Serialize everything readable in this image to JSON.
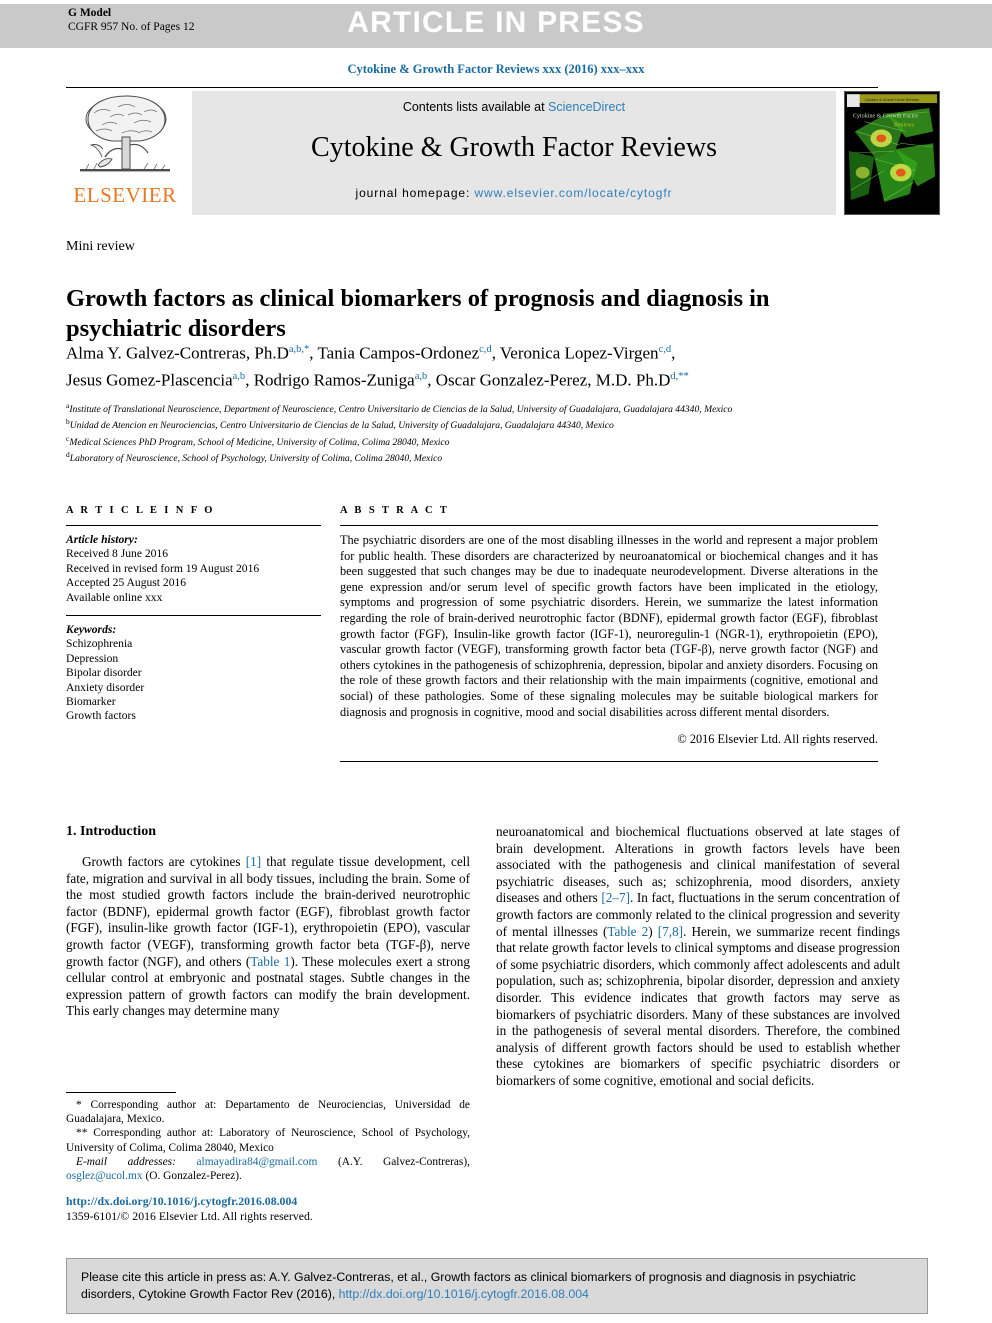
{
  "banner": {
    "g_model_line1": "G Model",
    "g_model_line2": "CGFR 957 No. of Pages 12",
    "article_in_press": "ARTICLE IN PRESS"
  },
  "running_head": "Cytokine & Growth Factor Reviews xxx (2016) xxx–xxx",
  "masthead": {
    "contents_prefix": "Contents lists available at ",
    "sciencedirect": "ScienceDirect",
    "journal_title": "Cytokine & Growth Factor Reviews",
    "homepage_prefix": "journal homepage: ",
    "homepage_url": "www.elsevier.com/locate/cytogfr",
    "publisher": "ELSEVIER",
    "cover_title": "Cytokine & Growth Factor",
    "cover_subtitle": "Reviews"
  },
  "article": {
    "type": "Mini review",
    "title": "Growth factors as clinical biomarkers of prognosis and diagnosis in psychiatric disorders",
    "authors_line1_a": "Alma Y. Galvez-Contreras, Ph.D",
    "authors_line1_a_sup": "a,b,*",
    "authors_line1_b": ", Tania Campos-Ordonez",
    "authors_line1_b_sup": "c,d",
    "authors_line1_c": ", Veronica Lopez-Virgen",
    "authors_line1_c_sup": "c,d",
    "authors_line1_d": ",",
    "authors_line2_a": "Jesus Gomez-Plascencia",
    "authors_line2_a_sup": "a,b",
    "authors_line2_b": ", Rodrigo Ramos-Zuniga",
    "authors_line2_b_sup": "a,b",
    "authors_line2_c": ", Oscar Gonzalez-Perez, M.D. Ph.D",
    "authors_line2_c_sup": "d,**",
    "affiliations": [
      {
        "mark": "a",
        "text": "Institute of Translational Neuroscience, Department of Neuroscience, Centro Universitario de Ciencias de la Salud, University of Guadalajara, Guadalajara 44340, Mexico"
      },
      {
        "mark": "b",
        "text": "Unidad de Atencion en Neurociencias, Centro Universitario de Ciencias de la Salud, University of Guadalajara, Guadalajara 44340, Mexico"
      },
      {
        "mark": "c",
        "text": "Medical Sciences PhD Program, School of Medicine, University of Colima, Colima 28040, Mexico"
      },
      {
        "mark": "d",
        "text": "Laboratory of Neuroscience, School of Psychology, University of Colima, Colima 28040, Mexico"
      }
    ]
  },
  "article_info": {
    "heading": "A R T I C L E  I N F O",
    "history_label": "Article history:",
    "history": [
      "Received 8 June 2016",
      "Received in revised form 19 August 2016",
      "Accepted 25 August 2016",
      "Available online xxx"
    ],
    "keywords_label": "Keywords:",
    "keywords": [
      "Schizophrenia",
      "Depression",
      "Bipolar disorder",
      "Anxiety disorder",
      "Biomarker",
      "Growth factors"
    ]
  },
  "abstract": {
    "heading": "A B S T R A C T",
    "text": "The psychiatric disorders are one of the most disabling illnesses in the world and represent a major problem for public health. These disorders are characterized by neuroanatomical or biochemical changes and it has been suggested that such changes may be due to inadequate neurodevelopment. Diverse alterations in the gene expression and/or serum level of specific growth factors have been implicated in the etiology, symptoms and progression of some psychiatric disorders. Herein, we summarize the latest information regarding the role of brain-derived neurotrophic factor (BDNF), epidermal growth factor (EGF), fibroblast growth factor (FGF), Insulin-like growth factor (IGF-1), neuroregulin-1 (NGR-1), erythropoietin (EPO), vascular growth factor (VEGF), transforming growth factor beta (TGF-β), nerve growth factor (NGF) and others cytokines in the pathogenesis of schizophrenia, depression, bipolar and anxiety disorders. Focusing on the role of these growth factors and their relationship with the main impairments (cognitive, emotional and social) of these pathologies. Some of these signaling molecules may be suitable biological markers for diagnosis and prognosis in cognitive, mood and social disabilities across different mental disorders.",
    "copyright": "© 2016 Elsevier Ltd. All rights reserved."
  },
  "body": {
    "section_heading": "1. Introduction",
    "left_paragraph_parts": {
      "p1": "Growth factors are cytokines ",
      "ref1": "[1]",
      "p2": " that regulate tissue development, cell fate, migration and survival in all body tissues, including the brain. Some of the most studied growth factors include the brain-derived neurotrophic factor (BDNF), epidermal growth factor (EGF), fibroblast growth factor (FGF), insulin-like growth factor (IGF-1), erythropoietin (EPO), vascular growth factor (VEGF), transforming growth factor beta (TGF-β), nerve growth factor (NGF), and others (",
      "ref2": "Table 1",
      "p3": "). These molecules exert a strong cellular control at embryonic and postnatal stages. Subtle changes in the expression pattern of growth factors can modify the brain development. This early changes may determine many"
    },
    "right_paragraph_parts": {
      "p1": "neuroanatomical and biochemical fluctuations observed at late stages of brain development. Alterations in growth factors levels have been associated with the pathogenesis and clinical manifestation of several psychiatric diseases, such as; schizophrenia, mood disorders, anxiety diseases and others ",
      "ref1": "[2–7]",
      "p2": ". In fact, fluctuations in the serum concentration of growth factors are commonly related to the clinical progression and severity of mental illnesses (",
      "ref2": "Table 2",
      "p3": ") ",
      "ref3": "[7,8]",
      "p4": ". Herein, we summarize recent findings that relate growth factor levels to clinical symptoms and disease progression of some psychiatric disorders, which commonly affect adolescents and adult population, such as; schizophrenia, bipolar disorder, depression and anxiety disorder. This evidence indicates that growth factors may serve as biomarkers of psychiatric disorders. Many of these substances are involved in the pathogenesis of several mental disorders. Therefore, the combined analysis of different growth factors should be used to establish whether these cytokines are biomarkers of specific psychiatric disorders or biomarkers of some cognitive, emotional and social deficits."
    }
  },
  "footnotes": {
    "note1_mark": "*",
    "note1": " Corresponding author at: Departamento de Neurociencias, Universidad de Guadalajara, Mexico.",
    "note2_mark": "**",
    "note2": " Corresponding author at: Laboratory of Neuroscience, School of Psychology, University of Colima, Colima 28040, Mexico",
    "email_label": "E-mail addresses:",
    "email1": "almayadira84@gmail.com",
    "email1_owner": " (A.Y. Galvez-Contreras),",
    "email2": "osglez@ucol.mx",
    "email2_owner": " (O. Gonzalez-Perez)."
  },
  "doi_block": {
    "doi_url": "http://dx.doi.org/10.1016/j.cytogfr.2016.08.004",
    "issn_line": "1359-6101/© 2016 Elsevier Ltd. All rights reserved."
  },
  "cite_box": {
    "text_a": "Please cite this article in press as: A.Y. Galvez-Contreras, et al., Growth factors as clinical biomarkers of prognosis and diagnosis in psychiatric disorders, Cytokine Growth Factor Rev (2016), ",
    "link": "http://dx.doi.org/10.1016/j.cytogfr.2016.08.004"
  },
  "colors": {
    "link_blue": "#2e7fb8",
    "head_blue": "#1a6ba0",
    "elsevier_orange": "#e87722",
    "banner_grey": "#c9c9c9",
    "panel_grey": "#e6e6e6",
    "cite_grey": "#d9d9d9"
  }
}
